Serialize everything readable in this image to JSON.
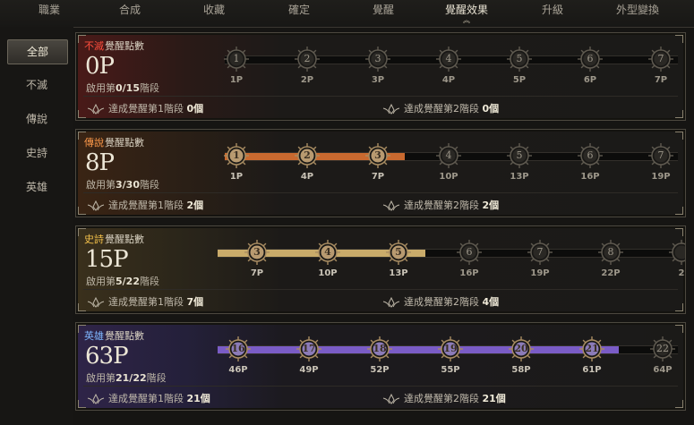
{
  "tabs": [
    "職業",
    "合成",
    "收藏",
    "確定",
    "覺醒",
    "覺醒效果",
    "升級",
    "外型變換"
  ],
  "active_tab_index": 5,
  "sidebar": [
    "全部",
    "不滅",
    "傳說",
    "史詩",
    "英雄"
  ],
  "active_sidebar_index": 0,
  "stage_prefix": "啟用第",
  "stage_suffix": "階段",
  "ach1_label": "達成覺醒第1階段",
  "ach2_label": "達成覺醒第2階段",
  "panels": [
    {
      "key": "imm",
      "grade": "不滅",
      "grade_color": "#ff4d3d",
      "title_rest": "覺醒點數",
      "points": "0P",
      "stage": "0/15",
      "ach1": "0個",
      "ach2": "0個",
      "fill_color": "#000000",
      "fill_to": 0,
      "nodes": [
        {
          "n": "1",
          "p": "1P",
          "on": false
        },
        {
          "n": "2",
          "p": "2P",
          "on": false
        },
        {
          "n": "3",
          "p": "3P",
          "on": false
        },
        {
          "n": "4",
          "p": "4P",
          "on": false
        },
        {
          "n": "5",
          "p": "5P",
          "on": false
        },
        {
          "n": "6",
          "p": "6P",
          "on": false
        },
        {
          "n": "7",
          "p": "7P",
          "on": false
        }
      ]
    },
    {
      "key": "leg",
      "grade": "傳說",
      "grade_color": "#ff9a4a",
      "title_rest": "覺醒點數",
      "points": "8P",
      "stage": "3/30",
      "ach1": "2個",
      "ach2": "2個",
      "fill_color": "#c9692f",
      "fill_to": 3,
      "nodes": [
        {
          "n": "1",
          "p": "1P",
          "on": true
        },
        {
          "n": "2",
          "p": "4P",
          "on": true
        },
        {
          "n": "3",
          "p": "7P",
          "on": true
        },
        {
          "n": "4",
          "p": "10P",
          "on": false
        },
        {
          "n": "5",
          "p": "13P",
          "on": false
        },
        {
          "n": "6",
          "p": "16P",
          "on": false
        },
        {
          "n": "7",
          "p": "19P",
          "on": false
        }
      ]
    },
    {
      "key": "epi",
      "grade": "史詩",
      "grade_color": "#f2c04a",
      "title_rest": "覺醒點數",
      "points": "15P",
      "stage": "5/22",
      "ach1": "7個",
      "ach2": "4個",
      "fill_color": "#c9ab6a",
      "fill_to": 3,
      "nodes": [
        {
          "n": "3",
          "p": "7P",
          "on": true
        },
        {
          "n": "4",
          "p": "10P",
          "on": true
        },
        {
          "n": "5",
          "p": "13P",
          "on": true
        },
        {
          "n": "6",
          "p": "16P",
          "on": false
        },
        {
          "n": "7",
          "p": "19P",
          "on": false
        },
        {
          "n": "8",
          "p": "22P",
          "on": false
        },
        {
          "n": "",
          "p": "2",
          "on": false
        }
      ]
    },
    {
      "key": "her",
      "grade": "英雄",
      "grade_color": "#7fb7ff",
      "title_rest": "覺醒點數",
      "points": "63P",
      "stage": "21/22",
      "ach1": "21個",
      "ach2": "21個",
      "fill_color": "#7a5cc6",
      "fill_to": 6,
      "nodes": [
        {
          "n": "16",
          "p": "46P",
          "on": true
        },
        {
          "n": "17",
          "p": "49P",
          "on": true
        },
        {
          "n": "18",
          "p": "52P",
          "on": true
        },
        {
          "n": "19",
          "p": "55P",
          "on": true
        },
        {
          "n": "20",
          "p": "58P",
          "on": true
        },
        {
          "n": "21",
          "p": "61P",
          "on": true
        },
        {
          "n": "22",
          "p": "64P",
          "on": false
        }
      ]
    }
  ]
}
